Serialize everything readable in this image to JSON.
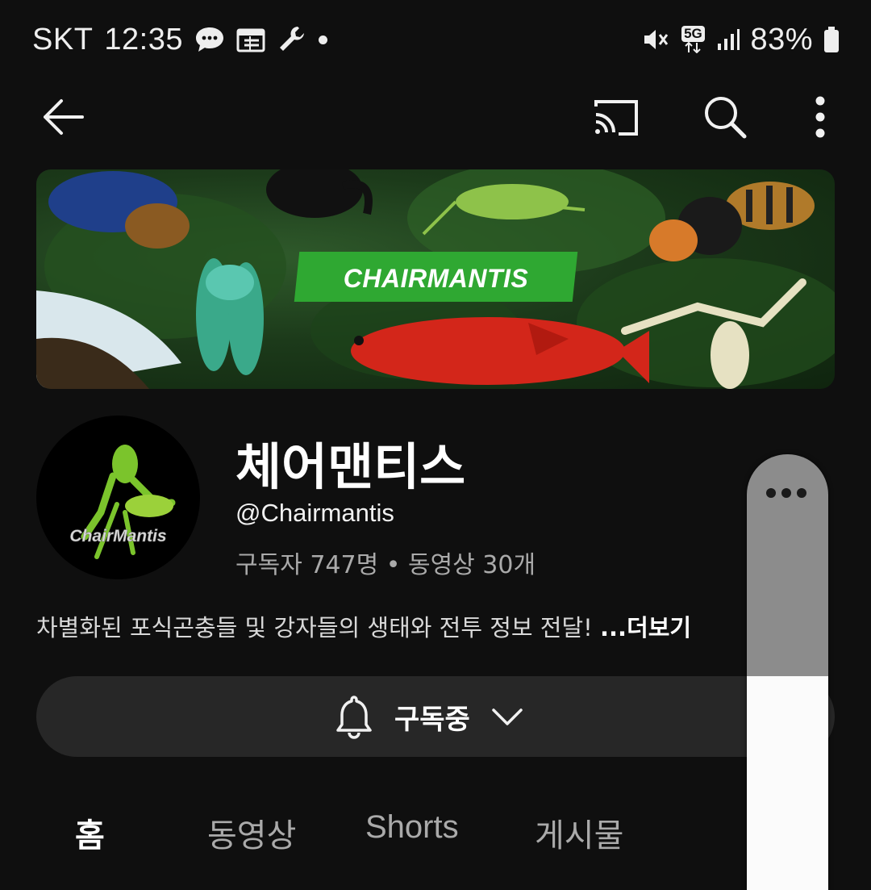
{
  "status_bar": {
    "carrier": "SKT",
    "time": "12:35",
    "network": "5G",
    "battery": "83%",
    "icons": [
      "chat-icon",
      "calendar-icon",
      "wrench-icon",
      "notification-dot",
      "mute-icon",
      "5g-icon",
      "signal-icon",
      "battery-icon"
    ]
  },
  "app_bar": {
    "icons": [
      "back-arrow-icon",
      "cast-icon",
      "search-icon",
      "more-vert-icon"
    ]
  },
  "banner": {
    "title": "CHAIRMANTIS"
  },
  "channel": {
    "avatar_text": "ChairMantis",
    "name": "체어맨티스",
    "handle": "@Chairmantis",
    "stats": "구독자 747명 • 동영상 30개",
    "description": "차별화된 포식곤충들 및 강자들의 생태와 전투 정보 전달! ",
    "more_label": "...더보기"
  },
  "subscribe": {
    "label": "구독중",
    "icons": [
      "bell-icon",
      "chevron-down-icon"
    ]
  },
  "tabs": [
    {
      "label": "홈",
      "active": true
    },
    {
      "label": "동영상",
      "active": false
    },
    {
      "label": "Shorts",
      "active": false
    },
    {
      "label": "게시물",
      "active": false
    }
  ],
  "colors": {
    "background": "#0f0f0f",
    "subscribe_bg": "#272727",
    "banner_tag": "#2fa832"
  }
}
